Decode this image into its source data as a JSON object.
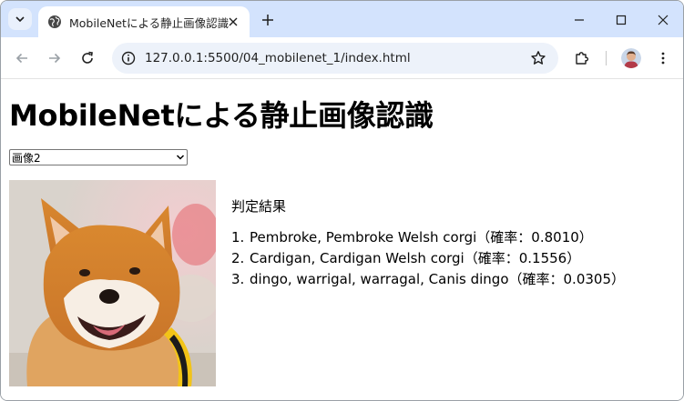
{
  "browser": {
    "tab": {
      "title": "MobileNetによる静止画像認識"
    },
    "address": {
      "url": "127.0.0.1:5500/04_mobilenet_1/index.html"
    },
    "icons": {
      "tab_search": "chevron-down-icon",
      "favicon": "globe-icon",
      "close": "close-icon",
      "new_tab": "plus-icon",
      "minimize": "minimize-icon",
      "maximize": "maximize-icon",
      "window_close": "close-icon",
      "back": "back-arrow-icon",
      "forward": "forward-arrow-icon",
      "reload": "reload-icon",
      "site_info": "site-info-icon",
      "bookmark": "star-icon",
      "extensions": "puzzle-icon",
      "profile": "avatar",
      "menu": "more-vert-icon"
    },
    "colors": {
      "tabstrip": "#d3e3fd",
      "omnibox": "#edf2fa"
    }
  },
  "page": {
    "title": "MobileNetによる静止画像認識",
    "select": {
      "selected": "画像2"
    },
    "image": {
      "subject": "shiba-inu-dog-photo"
    },
    "results": {
      "heading": "判定結果",
      "items": [
        {
          "index": "1.",
          "text": "Pembroke, Pembroke Welsh corgi（確率：0.8010）"
        },
        {
          "index": "2.",
          "text": "Cardigan, Cardigan Welsh corgi（確率：0.1556）"
        },
        {
          "index": "3.",
          "text": "dingo, warrigal, warragal, Canis dingo（確率：0.0305）"
        }
      ]
    }
  }
}
